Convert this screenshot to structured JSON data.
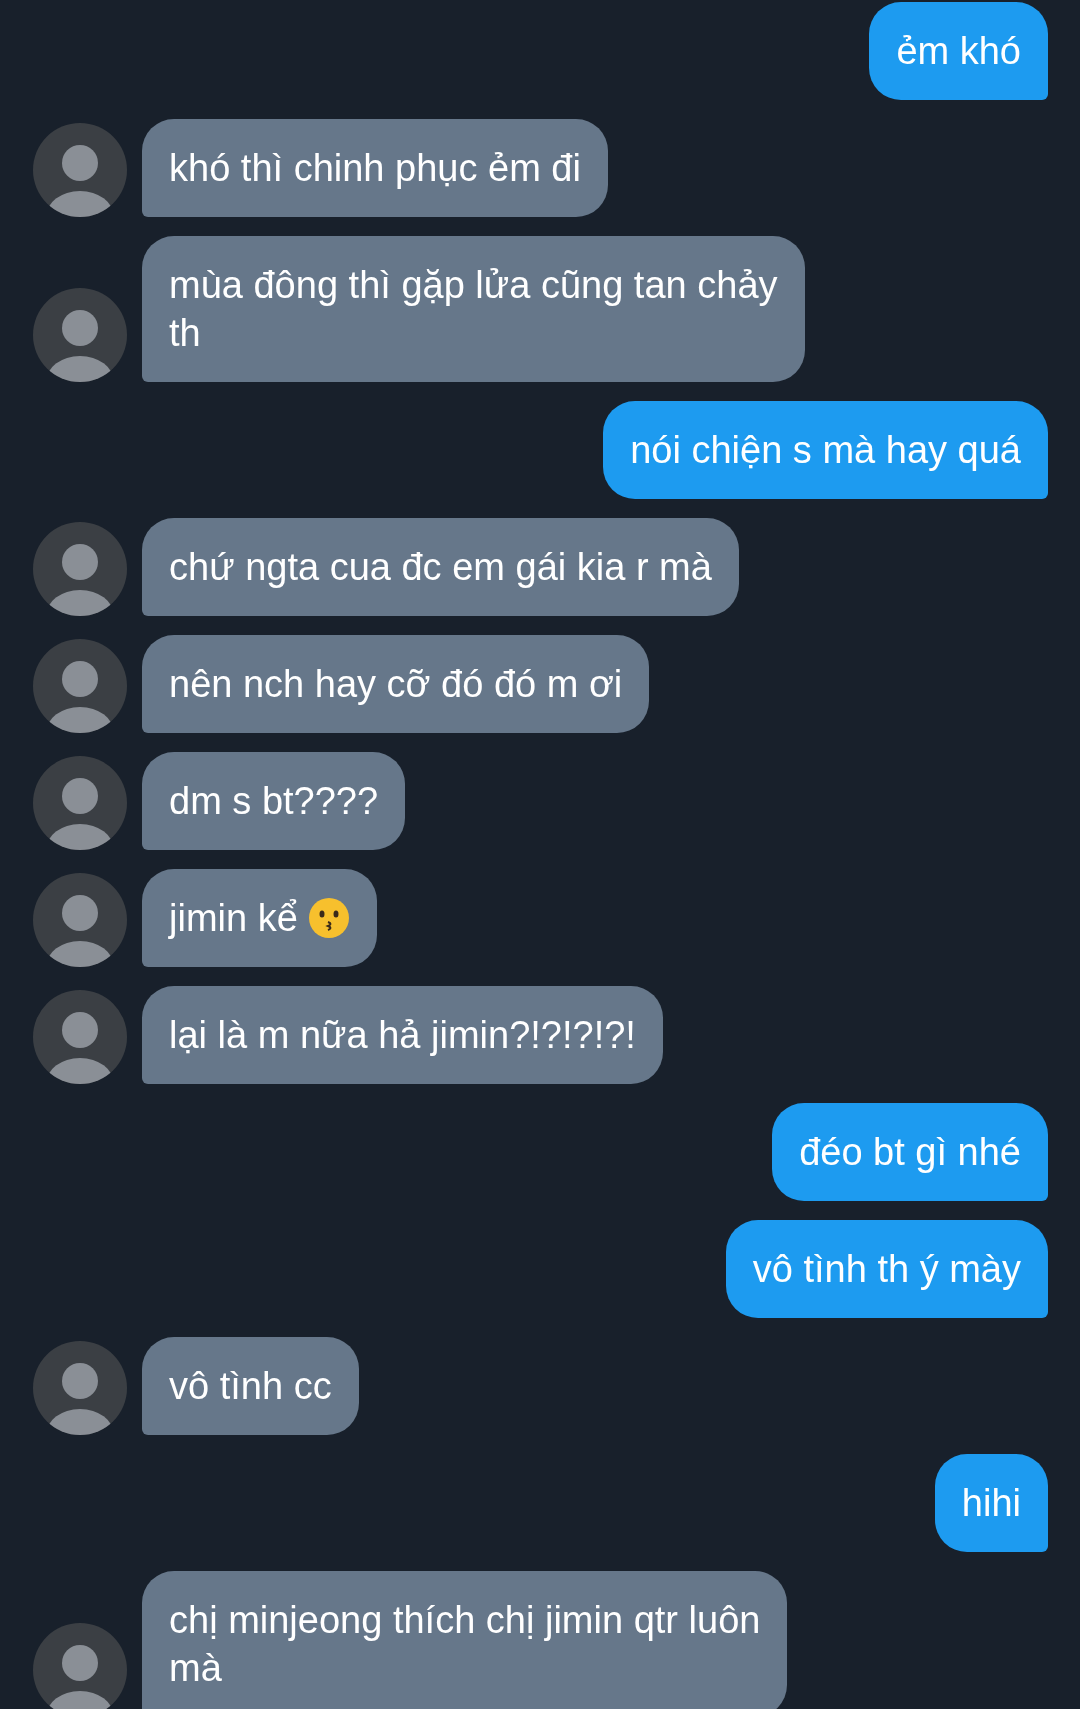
{
  "messages": [
    {
      "kind": "outgoing",
      "lines": [
        "ẻm khó"
      ]
    },
    {
      "kind": "incoming",
      "lines": [
        "khó thì chinh phục ẻm đi"
      ]
    },
    {
      "kind": "incoming",
      "lines": [
        "mùa đông thì gặp lửa cũng tan chảy",
        "th"
      ]
    },
    {
      "kind": "outgoing",
      "lines": [
        "nói chiện s mà hay quá"
      ]
    },
    {
      "kind": "incoming",
      "lines": [
        "chứ ngta cua đc em gái kia r mà"
      ]
    },
    {
      "kind": "incoming",
      "lines": [
        "nên nch hay cỡ đó đó m ơi"
      ]
    },
    {
      "kind": "incoming",
      "lines": [
        "dm s bt????"
      ]
    },
    {
      "kind": "incoming",
      "lines": [
        "jimin kể"
      ],
      "emoji": true
    },
    {
      "kind": "incoming",
      "lines": [
        "lại là m nữa hả jimin?!?!?!?!"
      ]
    },
    {
      "kind": "outgoing",
      "lines": [
        "đéo bt gì nhé"
      ]
    },
    {
      "kind": "outgoing",
      "lines": [
        "vô tình th ý mày"
      ]
    },
    {
      "kind": "incoming",
      "lines": [
        "vô tình cc"
      ]
    },
    {
      "kind": "outgoing",
      "lines": [
        "hihi"
      ]
    },
    {
      "kind": "incoming",
      "lines": [
        "chị minjeong thích chị jimin qtr luôn",
        "mà"
      ]
    }
  ]
}
